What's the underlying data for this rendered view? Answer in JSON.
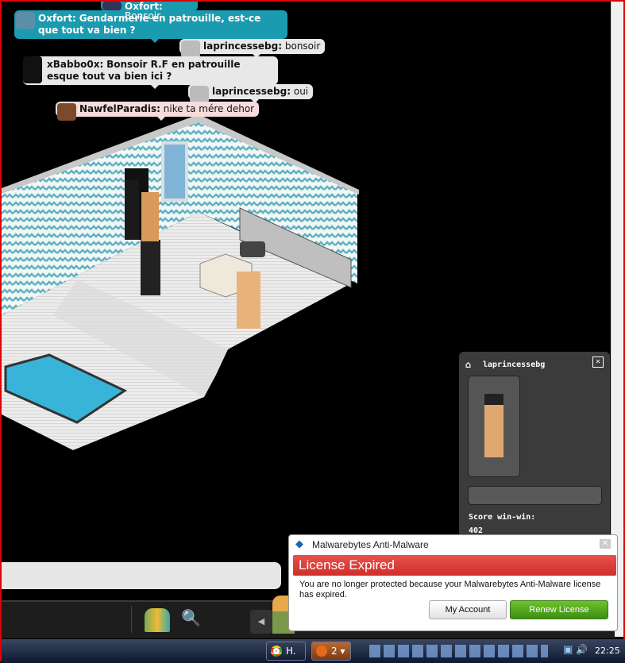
{
  "chat": {
    "messages": [
      {
        "user": "Oxfort:",
        "text": "Bonsoir",
        "style": "blue"
      },
      {
        "user": "Oxfort:",
        "text": "Gendarmerie en patrouille, est-ce que tout va bien ?",
        "style": "blue"
      },
      {
        "user": "laprincessebg:",
        "text": "bonsoir",
        "style": "gray"
      },
      {
        "user": "xBabbo0x:",
        "text": "Bonsoir R.F en patrouille esque tout va bien ici ?",
        "style": "gray"
      },
      {
        "user": "laprincessebg:",
        "text": "oui",
        "style": "gray"
      },
      {
        "user": "NawfelParadis:",
        "text": "nike ta mére dehor",
        "style": "pink"
      }
    ],
    "input_placeholder": ""
  },
  "profile": {
    "name": "laprincessebg",
    "score_label": "Score win-win:",
    "score": "402",
    "motto": ""
  },
  "popup": {
    "app": "Malwarebytes Anti-Malware",
    "title": "License Expired",
    "message": "You are no longer protected because your Malwarebytes Anti-Malware license has expired.",
    "my_account": "My Account",
    "renew": "Renew License"
  },
  "taskbar": {
    "item1": "H.",
    "item2": "2",
    "clock": "22:25"
  },
  "colors": {
    "blue_bubble": "#1a9bb0",
    "popup_red": "#d83a36",
    "renew_green": "#4ea21c",
    "border": "#e00000"
  }
}
